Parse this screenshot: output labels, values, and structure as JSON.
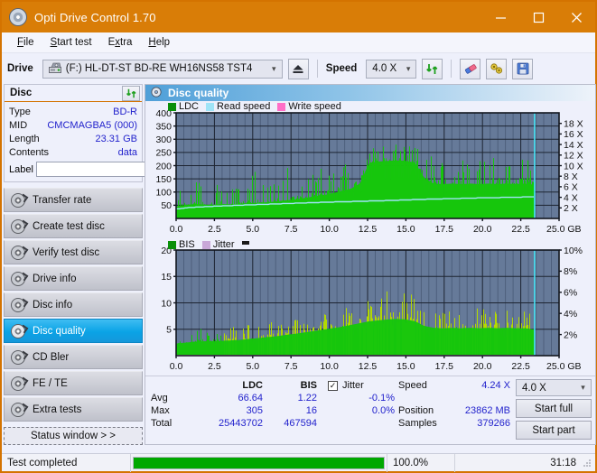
{
  "window": {
    "title": "Opti Drive Control 1.70",
    "icon": "disc-icon",
    "minimize": "minimize-icon",
    "maximize": "maximize-icon",
    "close": "close-icon"
  },
  "menu": [
    {
      "label": "File",
      "accel": "F"
    },
    {
      "label": "Start test",
      "accel": "S"
    },
    {
      "label": "Extra",
      "accel": "x"
    },
    {
      "label": "Help",
      "accel": "H"
    }
  ],
  "toolbar": {
    "drive_label": "Drive",
    "drive_value": "(F:)  HL-DT-ST BD-RE  WH16NS58 TST4",
    "eject": "eject-icon",
    "speed_label": "Speed",
    "speed_value": "4.0 X",
    "refresh": "refresh-icon",
    "erase": "eraser-icon",
    "settings": "plug-icon",
    "save": "floppy-save-icon"
  },
  "disc": {
    "header": "Disc",
    "refresh": "refresh-icon",
    "rows": [
      {
        "key": "Type",
        "value": "BD-R"
      },
      {
        "key": "MID",
        "value": "CMCMAGBA5 (000)"
      },
      {
        "key": "Length",
        "value": "23.31 GB"
      },
      {
        "key": "Contents",
        "value": "data"
      }
    ],
    "label_key": "Label",
    "label_value": "",
    "label_button": "disc-label-icon"
  },
  "nav": [
    {
      "label": "Transfer rate",
      "active": false
    },
    {
      "label": "Create test disc",
      "active": false
    },
    {
      "label": "Verify test disc",
      "active": false
    },
    {
      "label": "Drive info",
      "active": false
    },
    {
      "label": "Disc info",
      "active": false
    },
    {
      "label": "Disc quality",
      "active": true
    },
    {
      "label": "CD Bler",
      "active": false
    },
    {
      "label": "FE / TE",
      "active": false
    },
    {
      "label": "Extra tests",
      "active": false
    }
  ],
  "status_window_button": "Status window > >",
  "main": {
    "title": "Disc quality",
    "icon": "disc-quality-icon"
  },
  "colors": {
    "plot_bg": "#667a99",
    "grid": "#2c3444",
    "ldc_green": "#16c60c",
    "bis_green": "#16c60c",
    "jitter_yellow": "#b3d900",
    "read_speed": "#9fe4f7",
    "write_speed": "#ff6ec7",
    "cursor": "#46e0f2",
    "accent_orange": "#d97d07",
    "value_blue": "#2222cc",
    "highlight_blue": "#0aa3e6"
  },
  "chart_data": [
    {
      "type": "area",
      "name": "ldc-chart",
      "title": "LDC",
      "xlabel": "GB",
      "ylabel": "LDC",
      "xlim": [
        0.0,
        25.0
      ],
      "ylim": [
        0,
        400
      ],
      "xticks": [
        0.0,
        2.5,
        5.0,
        7.5,
        10.0,
        12.5,
        15.0,
        17.5,
        20.0,
        22.5,
        25.0
      ],
      "xticklabels": [
        "0.0",
        "2.5",
        "5.0",
        "7.5",
        "10.0",
        "12.5",
        "15.0",
        "17.5",
        "20.0",
        "22.5",
        "25.0 GB"
      ],
      "yticks": [
        50,
        100,
        150,
        200,
        250,
        300,
        350,
        400
      ],
      "yticklabels": [
        "50",
        "100",
        "150",
        "200",
        "250",
        "300",
        "350",
        "400"
      ],
      "y2lim": [
        0,
        20
      ],
      "y2ticks": [
        2,
        4,
        6,
        8,
        10,
        12,
        14,
        16,
        18
      ],
      "y2ticklabels": [
        "2 X",
        "4 X",
        "6 X",
        "8 X",
        "10 X",
        "12 X",
        "14 X",
        "16 X",
        "18 X"
      ],
      "grid": true,
      "legend": [
        {
          "label": "LDC",
          "color": "#16c60c"
        },
        {
          "label": "Read speed",
          "color": "#9fe4f7"
        },
        {
          "label": "Write speed",
          "color": "#ff6ec7"
        }
      ],
      "data_end_gb": 23.4,
      "ldc_envelope": [
        {
          "x": 0.0,
          "avg": 52,
          "peak": 95
        },
        {
          "x": 0.6,
          "avg": 58,
          "peak": 120
        },
        {
          "x": 1.2,
          "avg": 62,
          "peak": 135
        },
        {
          "x": 1.8,
          "avg": 60,
          "peak": 175
        },
        {
          "x": 2.4,
          "avg": 58,
          "peak": 130
        },
        {
          "x": 3.0,
          "avg": 62,
          "peak": 125
        },
        {
          "x": 3.6,
          "avg": 60,
          "peak": 140
        },
        {
          "x": 4.2,
          "avg": 64,
          "peak": 130
        },
        {
          "x": 4.8,
          "avg": 66,
          "peak": 145
        },
        {
          "x": 5.4,
          "avg": 68,
          "peak": 230
        },
        {
          "x": 6.0,
          "avg": 70,
          "peak": 160
        },
        {
          "x": 6.6,
          "avg": 74,
          "peak": 155
        },
        {
          "x": 7.2,
          "avg": 78,
          "peak": 195
        },
        {
          "x": 7.8,
          "avg": 82,
          "peak": 165
        },
        {
          "x": 8.4,
          "avg": 88,
          "peak": 175
        },
        {
          "x": 9.0,
          "avg": 95,
          "peak": 185
        },
        {
          "x": 9.6,
          "avg": 100,
          "peak": 200
        },
        {
          "x": 10.2,
          "avg": 108,
          "peak": 205
        },
        {
          "x": 10.8,
          "avg": 118,
          "peak": 215
        },
        {
          "x": 11.4,
          "avg": 128,
          "peak": 225
        },
        {
          "x": 12.0,
          "avg": 150,
          "peak": 235
        },
        {
          "x": 12.6,
          "avg": 240,
          "peak": 275
        },
        {
          "x": 13.2,
          "avg": 245,
          "peak": 285
        },
        {
          "x": 13.8,
          "avg": 248,
          "peak": 290
        },
        {
          "x": 14.4,
          "avg": 250,
          "peak": 300
        },
        {
          "x": 15.0,
          "avg": 248,
          "peak": 310
        },
        {
          "x": 15.6,
          "avg": 240,
          "peak": 280
        },
        {
          "x": 16.2,
          "avg": 175,
          "peak": 255
        },
        {
          "x": 16.8,
          "avg": 150,
          "peak": 230
        },
        {
          "x": 17.4,
          "avg": 148,
          "peak": 225
        },
        {
          "x": 18.0,
          "avg": 150,
          "peak": 235
        },
        {
          "x": 18.6,
          "avg": 148,
          "peak": 230
        },
        {
          "x": 19.2,
          "avg": 150,
          "peak": 240
        },
        {
          "x": 19.8,
          "avg": 148,
          "peak": 225
        },
        {
          "x": 20.4,
          "avg": 150,
          "peak": 240
        },
        {
          "x": 21.0,
          "avg": 148,
          "peak": 230
        },
        {
          "x": 21.6,
          "avg": 150,
          "peak": 245
        },
        {
          "x": 22.2,
          "avg": 148,
          "peak": 230
        },
        {
          "x": 22.8,
          "avg": 150,
          "peak": 235
        },
        {
          "x": 23.4,
          "avg": 145,
          "peak": 215
        }
      ],
      "read_speed_curve": [
        {
          "x": 0.0,
          "v": 1.8
        },
        {
          "x": 1.0,
          "v": 2.1
        },
        {
          "x": 2.5,
          "v": 2.3
        },
        {
          "x": 4.0,
          "v": 2.5
        },
        {
          "x": 6.0,
          "v": 2.7
        },
        {
          "x": 8.0,
          "v": 2.9
        },
        {
          "x": 10.0,
          "v": 3.1
        },
        {
          "x": 12.0,
          "v": 3.25
        },
        {
          "x": 14.0,
          "v": 3.4
        },
        {
          "x": 16.0,
          "v": 3.6
        },
        {
          "x": 18.0,
          "v": 3.75
        },
        {
          "x": 20.0,
          "v": 3.9
        },
        {
          "x": 22.0,
          "v": 4.0
        },
        {
          "x": 23.4,
          "v": 4.1
        }
      ]
    },
    {
      "type": "area",
      "name": "bis-jitter-chart",
      "title": "BIS",
      "xlabel": "GB",
      "ylabel": "BIS",
      "xlim": [
        0.0,
        25.0
      ],
      "ylim": [
        0,
        20
      ],
      "xticks": [
        0.0,
        2.5,
        5.0,
        7.5,
        10.0,
        12.5,
        15.0,
        17.5,
        20.0,
        22.5,
        25.0
      ],
      "xticklabels": [
        "0.0",
        "2.5",
        "5.0",
        "7.5",
        "10.0",
        "12.5",
        "15.0",
        "17.5",
        "20.0",
        "22.5",
        "25.0 GB"
      ],
      "yticks": [
        5,
        10,
        15,
        20
      ],
      "yticklabels": [
        "5",
        "10",
        "15",
        "20"
      ],
      "y2lim": [
        0,
        10
      ],
      "y2ticks": [
        2,
        4,
        6,
        8,
        10
      ],
      "y2ticklabels": [
        "2%",
        "4%",
        "6%",
        "8%",
        "10%"
      ],
      "grid": true,
      "legend": [
        {
          "label": "BIS",
          "color": "#16c60c"
        },
        {
          "label": "Jitter",
          "color": "#c9a8d8"
        }
      ],
      "data_end_gb": 23.4,
      "bis_envelope": [
        {
          "x": 0.0,
          "avg": 2.6,
          "peak": 4.6
        },
        {
          "x": 0.6,
          "avg": 2.8,
          "peak": 4.9
        },
        {
          "x": 1.2,
          "avg": 3.0,
          "peak": 5.0
        },
        {
          "x": 1.8,
          "avg": 3.1,
          "peak": 5.2
        },
        {
          "x": 2.4,
          "avg": 3.1,
          "peak": 5.0
        },
        {
          "x": 3.0,
          "avg": 3.2,
          "peak": 5.1
        },
        {
          "x": 3.6,
          "avg": 3.3,
          "peak": 5.5
        },
        {
          "x": 4.2,
          "avg": 3.4,
          "peak": 5.3
        },
        {
          "x": 4.8,
          "avg": 3.6,
          "peak": 6.0
        },
        {
          "x": 5.4,
          "avg": 3.8,
          "peak": 8.0
        },
        {
          "x": 6.0,
          "avg": 4.0,
          "peak": 6.5
        },
        {
          "x": 6.6,
          "avg": 4.2,
          "peak": 6.6
        },
        {
          "x": 7.2,
          "avg": 4.5,
          "peak": 7.0
        },
        {
          "x": 7.8,
          "avg": 4.7,
          "peak": 7.2
        },
        {
          "x": 8.4,
          "avg": 5.0,
          "peak": 7.5
        },
        {
          "x": 9.0,
          "avg": 5.3,
          "peak": 7.8
        },
        {
          "x": 9.6,
          "avg": 5.6,
          "peak": 8.1
        },
        {
          "x": 10.2,
          "avg": 5.9,
          "peak": 8.5
        },
        {
          "x": 10.8,
          "avg": 6.2,
          "peak": 9.0
        },
        {
          "x": 11.4,
          "avg": 6.6,
          "peak": 9.4
        },
        {
          "x": 12.0,
          "avg": 7.0,
          "peak": 9.8
        },
        {
          "x": 12.6,
          "avg": 7.4,
          "peak": 12.0
        },
        {
          "x": 13.2,
          "avg": 7.6,
          "peak": 12.5
        },
        {
          "x": 13.8,
          "avg": 7.8,
          "peak": 13.5
        },
        {
          "x": 14.4,
          "avg": 7.9,
          "peak": 16.0
        },
        {
          "x": 15.0,
          "avg": 7.8,
          "peak": 13.0
        },
        {
          "x": 15.6,
          "avg": 7.4,
          "peak": 11.5
        },
        {
          "x": 16.2,
          "avg": 6.4,
          "peak": 10.0
        },
        {
          "x": 16.8,
          "avg": 6.0,
          "peak": 9.6
        },
        {
          "x": 17.4,
          "avg": 5.9,
          "peak": 9.4
        },
        {
          "x": 18.0,
          "avg": 6.0,
          "peak": 9.6
        },
        {
          "x": 18.6,
          "avg": 5.9,
          "peak": 9.5
        },
        {
          "x": 19.2,
          "avg": 6.0,
          "peak": 9.8
        },
        {
          "x": 19.8,
          "avg": 5.9,
          "peak": 9.4
        },
        {
          "x": 20.4,
          "avg": 6.0,
          "peak": 9.7
        },
        {
          "x": 21.0,
          "avg": 5.9,
          "peak": 9.5
        },
        {
          "x": 21.6,
          "avg": 6.0,
          "peak": 9.8
        },
        {
          "x": 22.2,
          "avg": 5.9,
          "peak": 9.4
        },
        {
          "x": 22.8,
          "avg": 5.9,
          "peak": 9.5
        },
        {
          "x": 23.4,
          "avg": 5.6,
          "peak": 9.0
        }
      ],
      "jitter_curve": [
        {
          "x": 0.0,
          "v": 0.0
        },
        {
          "x": 23.4,
          "v": 0.0
        }
      ]
    }
  ],
  "stats": {
    "col_ldc": "LDC",
    "col_bis": "BIS",
    "rows": [
      {
        "label": "Avg",
        "ldc": "66.64",
        "bis": "1.22",
        "jitter": "-0.1%"
      },
      {
        "label": "Max",
        "ldc": "305",
        "bis": "16",
        "jitter": "0.0%"
      },
      {
        "label": "Total",
        "ldc": "25443702",
        "bis": "467594",
        "jitter": ""
      }
    ],
    "jitter_label": "Jitter",
    "jitter_checked": true,
    "speed_label": "Speed",
    "speed_value": "4.24 X",
    "position_label": "Position",
    "position_value": "23862 MB",
    "samples_label": "Samples",
    "samples_value": "379266",
    "speed_select": "4.0 X",
    "start_full": "Start full",
    "start_part": "Start part"
  },
  "statusbar": {
    "message": "Test completed",
    "progress_percent": 100,
    "progress_text": "100.0%",
    "elapsed": "31:18"
  }
}
